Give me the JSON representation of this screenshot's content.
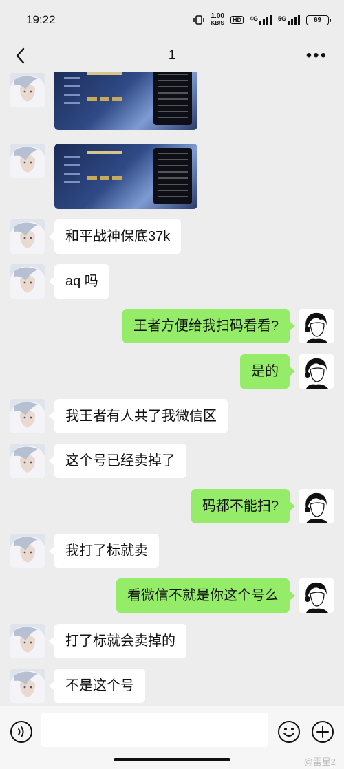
{
  "status_bar": {
    "time": "19:22",
    "net_speed_value": "1.00",
    "net_speed_unit": "KB/S",
    "hd_label": "HD",
    "signal1_label": "4G",
    "signal2_label": "5G",
    "battery": "69"
  },
  "nav": {
    "title": "1",
    "more_icon": "more-icon",
    "back_icon": "back-arrow-icon"
  },
  "messages": [
    {
      "side": "in",
      "type": "image"
    },
    {
      "side": "in",
      "type": "image"
    },
    {
      "side": "in",
      "type": "text",
      "text": "和平战神保底37k"
    },
    {
      "side": "in",
      "type": "text",
      "text": "aq 吗"
    },
    {
      "side": "out",
      "type": "text",
      "text": "王者方便给我扫码看看?"
    },
    {
      "side": "out",
      "type": "text",
      "text": "是的"
    },
    {
      "side": "in",
      "type": "text",
      "text": "我王者有人共了我微信区"
    },
    {
      "side": "in",
      "type": "text",
      "text": "这个号已经卖掉了"
    },
    {
      "side": "out",
      "type": "text",
      "text": "码都不能扫?"
    },
    {
      "side": "in",
      "type": "text",
      "text": "我打了标就卖"
    },
    {
      "side": "out",
      "type": "text",
      "text": "看微信不就是你这个号么"
    },
    {
      "side": "in",
      "type": "text",
      "text": "打了标就会卖掉的"
    },
    {
      "side": "in",
      "type": "text",
      "text": "不是这个号"
    }
  ],
  "input_bar": {
    "placeholder": "",
    "voice_icon": "voice-icon",
    "emoji_icon": "emoji-icon",
    "plus_icon": "plus-icon"
  },
  "watermark": "@雷星2",
  "colors": {
    "background": "#ededed",
    "outgoing_bubble": "#95ec69",
    "incoming_bubble": "#ffffff"
  }
}
